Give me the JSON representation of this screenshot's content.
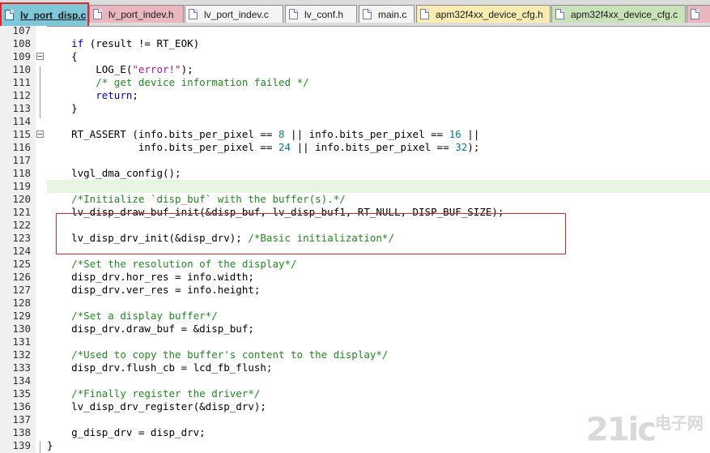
{
  "tabs": [
    {
      "label": "lv_port_disp.c",
      "style": "active",
      "icon": "file-icon"
    },
    {
      "label": "lv_port_indev.h",
      "style": "pink",
      "icon": "file-icon"
    },
    {
      "label": "lv_port_indev.c",
      "style": "plain",
      "icon": "file-icon"
    },
    {
      "label": "lv_conf.h",
      "style": "plain",
      "icon": "file-icon"
    },
    {
      "label": "main.c",
      "style": "plain",
      "icon": "file-icon"
    },
    {
      "label": "apm32f4xx_device_cfg.h",
      "style": "yellow",
      "icon": "file-icon"
    },
    {
      "label": "apm32f4xx_device_cfg.c",
      "style": "green",
      "icon": "file-icon"
    },
    {
      "label": "",
      "style": "pink",
      "icon": "file-icon"
    }
  ],
  "code_lines": [
    {
      "num": "107",
      "fold": false,
      "segments": []
    },
    {
      "num": "108",
      "fold": false,
      "segments": [
        [
          "    ",
          ""
        ],
        [
          "if",
          "k"
        ],
        [
          " (result != RT_EOK)",
          ""
        ]
      ]
    },
    {
      "num": "109",
      "fold": true,
      "segments": [
        [
          "    {",
          ""
        ]
      ]
    },
    {
      "num": "110",
      "fold": false,
      "segments": [
        [
          "        LOG_E(",
          ""
        ],
        [
          "\"error!\"",
          "s"
        ],
        [
          ");",
          ""
        ]
      ]
    },
    {
      "num": "111",
      "fold": false,
      "segments": [
        [
          "        ",
          ""
        ],
        [
          "/* get device information failed */",
          "c"
        ]
      ]
    },
    {
      "num": "112",
      "fold": false,
      "segments": [
        [
          "        ",
          ""
        ],
        [
          "return",
          "k"
        ],
        [
          ";",
          ""
        ]
      ]
    },
    {
      "num": "113",
      "fold": false,
      "segments": [
        [
          "    }",
          ""
        ]
      ]
    },
    {
      "num": "114",
      "fold": false,
      "segments": []
    },
    {
      "num": "115",
      "fold": true,
      "segments": [
        [
          "    RT_ASSERT (info.bits_per_pixel == ",
          ""
        ],
        [
          "8",
          "n"
        ],
        [
          " || info.bits_per_pixel == ",
          ""
        ],
        [
          "16",
          "n"
        ],
        [
          " ||",
          ""
        ]
      ]
    },
    {
      "num": "116",
      "fold": false,
      "segments": [
        [
          "               info.bits_per_pixel == ",
          ""
        ],
        [
          "24",
          "n"
        ],
        [
          " || info.bits_per_pixel == ",
          ""
        ],
        [
          "32",
          "n"
        ],
        [
          ");",
          ""
        ]
      ]
    },
    {
      "num": "117",
      "fold": false,
      "segments": []
    },
    {
      "num": "118",
      "fold": false,
      "segments": [
        [
          "    lvgl_dma_config();",
          ""
        ]
      ]
    },
    {
      "num": "119",
      "fold": false,
      "highlight": true,
      "segments": []
    },
    {
      "num": "120",
      "fold": false,
      "segments": [
        [
          "    ",
          ""
        ],
        [
          "/*Initialize `disp_buf` with the buffer(s).*/",
          "c"
        ]
      ]
    },
    {
      "num": "121",
      "fold": false,
      "segments": [
        [
          "    lv_disp_draw_buf_init(&disp_buf, lv_disp_buf1, RT_NULL, DISP_BUF_SIZE);",
          ""
        ]
      ]
    },
    {
      "num": "122",
      "fold": false,
      "segments": []
    },
    {
      "num": "123",
      "fold": false,
      "segments": [
        [
          "    lv_disp_drv_init(&disp_drv); ",
          ""
        ],
        [
          "/*Basic initialization*/",
          "c"
        ]
      ]
    },
    {
      "num": "124",
      "fold": false,
      "segments": []
    },
    {
      "num": "125",
      "fold": false,
      "segments": [
        [
          "    ",
          ""
        ],
        [
          "/*Set the resolution of the display*/",
          "c"
        ]
      ]
    },
    {
      "num": "126",
      "fold": false,
      "segments": [
        [
          "    disp_drv.hor_res = info.width;",
          ""
        ]
      ]
    },
    {
      "num": "127",
      "fold": false,
      "segments": [
        [
          "    disp_drv.ver_res = info.height;",
          ""
        ]
      ]
    },
    {
      "num": "128",
      "fold": false,
      "segments": []
    },
    {
      "num": "129",
      "fold": false,
      "segments": [
        [
          "    ",
          ""
        ],
        [
          "/*Set a display buffer*/",
          "c"
        ]
      ]
    },
    {
      "num": "130",
      "fold": false,
      "segments": [
        [
          "    disp_drv.draw_buf = &disp_buf;",
          ""
        ]
      ]
    },
    {
      "num": "131",
      "fold": false,
      "segments": []
    },
    {
      "num": "132",
      "fold": false,
      "segments": [
        [
          "    ",
          ""
        ],
        [
          "/*Used to copy the buffer's content to the display*/",
          "c"
        ]
      ]
    },
    {
      "num": "133",
      "fold": false,
      "segments": [
        [
          "    disp_drv.flush_cb = lcd_fb_flush;",
          ""
        ]
      ]
    },
    {
      "num": "134",
      "fold": false,
      "segments": []
    },
    {
      "num": "135",
      "fold": false,
      "segments": [
        [
          "    ",
          ""
        ],
        [
          "/*Finally register the driver*/",
          "c"
        ]
      ]
    },
    {
      "num": "136",
      "fold": false,
      "segments": [
        [
          "    lv_disp_drv_register(&disp_drv);",
          ""
        ]
      ]
    },
    {
      "num": "137",
      "fold": false,
      "segments": []
    },
    {
      "num": "138",
      "fold": false,
      "segments": [
        [
          "    g_disp_drv = disp_drv;",
          ""
        ]
      ]
    },
    {
      "num": "139",
      "fold": false,
      "segments": [
        [
          "}",
          ""
        ]
      ]
    }
  ],
  "watermark": {
    "text": "21ic",
    "sub": "电子网"
  },
  "colors": {
    "comment": "#1f8a1f",
    "keyword": "#0000c8",
    "string": "#b0198a",
    "number": "#0a7d8c",
    "highlight_box": "#d8262b",
    "active_tab": "#7ec9d9"
  }
}
